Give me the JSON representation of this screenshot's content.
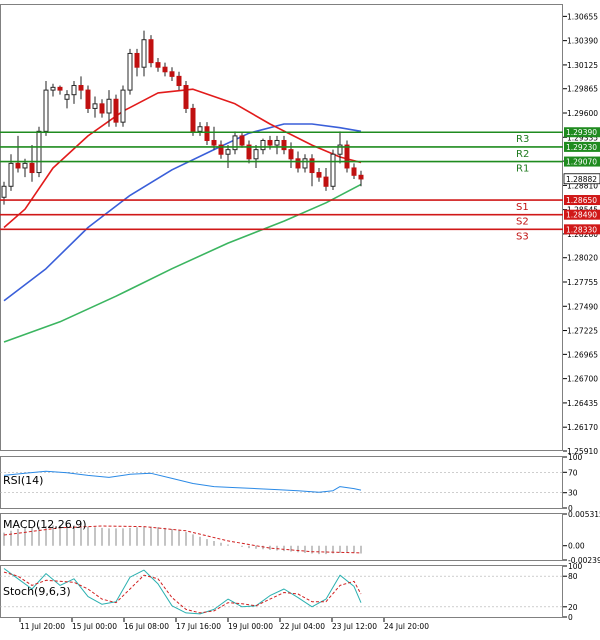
{
  "chart_data": [
    {
      "type": "candlestick",
      "panel": "main",
      "y_ticks": [
        "1.30655",
        "1.30390",
        "1.30125",
        "1.29865",
        "1.29600",
        "1.29335",
        "1.29075",
        "1.28810",
        "1.28545",
        "1.28280",
        "1.28020",
        "1.27755",
        "1.27490",
        "1.27225",
        "1.26965",
        "1.26700",
        "1.26435",
        "1.26170",
        "1.25910"
      ],
      "ylim": [
        1.2591,
        1.3079
      ],
      "x_labels": [
        "11 Jul 20:00",
        "15 Jul 00:00",
        "16 Jul 08:00",
        "17 Jul 16:00",
        "19 Jul 00:00",
        "22 Jul 04:00",
        "23 Jul 12:00",
        "24 Jul 20:00"
      ],
      "last_price": "1.28882",
      "colors": {
        "up": "#5a9a2a",
        "down": "#c01010",
        "ma_fast": "#e21b1b",
        "ma_mid": "#3a5fd9",
        "ma_slow": "#3bb560",
        "resistance": "#1f8b1f",
        "support": "#d01818"
      },
      "levels": [
        {
          "name": "R3",
          "value": 1.2939,
          "label": "1.29390"
        },
        {
          "name": "R2",
          "value": 1.2923,
          "label": "1.29230"
        },
        {
          "name": "R1",
          "value": 1.2907,
          "label": "1.29070"
        },
        {
          "name": "S1",
          "value": 1.2865,
          "label": "1.28650"
        },
        {
          "name": "S2",
          "value": 1.2849,
          "label": "1.28490"
        },
        {
          "name": "S3",
          "value": 1.2833,
          "label": "1.28330"
        }
      ],
      "candles": [
        [
          1.2868,
          1.2885,
          1.286,
          1.288
        ],
        [
          1.288,
          1.2915,
          1.2875,
          1.2905
        ],
        [
          1.2905,
          1.2935,
          1.2895,
          1.29
        ],
        [
          1.29,
          1.291,
          1.289,
          1.2905
        ],
        [
          1.2905,
          1.2925,
          1.2885,
          1.2895
        ],
        [
          1.2895,
          1.2945,
          1.289,
          1.294
        ],
        [
          1.294,
          1.2995,
          1.2935,
          1.2985
        ],
        [
          1.2985,
          1.2992,
          1.2978,
          1.2988
        ],
        [
          1.2988,
          1.299,
          1.298,
          1.2985
        ],
        [
          1.2975,
          1.2985,
          1.2965,
          1.298
        ],
        [
          1.298,
          1.2995,
          1.297,
          1.299
        ],
        [
          1.299,
          1.3,
          1.2975,
          1.2985
        ],
        [
          1.2985,
          1.299,
          1.296,
          1.2965
        ],
        [
          1.2965,
          1.2978,
          1.2955,
          1.297
        ],
        [
          1.297,
          1.2975,
          1.2955,
          1.296
        ],
        [
          1.296,
          1.2985,
          1.2945,
          1.2975
        ],
        [
          1.2975,
          1.298,
          1.2945,
          1.295
        ],
        [
          1.295,
          1.299,
          1.2945,
          1.2985
        ],
        [
          1.2985,
          1.303,
          1.298,
          1.3025
        ],
        [
          1.3025,
          1.303,
          1.3,
          1.301
        ],
        [
          1.301,
          1.305,
          1.3,
          1.304
        ],
        [
          1.304,
          1.3045,
          1.301,
          1.3015
        ],
        [
          1.3015,
          1.302,
          1.3005,
          1.301
        ],
        [
          1.301,
          1.3015,
          1.3,
          1.3005
        ],
        [
          1.3005,
          1.301,
          1.2995,
          1.3
        ],
        [
          1.3,
          1.3005,
          1.2985,
          1.299
        ],
        [
          1.299,
          1.2995,
          1.296,
          1.2965
        ],
        [
          1.2965,
          1.297,
          1.2935,
          1.294
        ],
        [
          1.294,
          1.295,
          1.2935,
          1.2945
        ],
        [
          1.2945,
          1.295,
          1.2925,
          1.293
        ],
        [
          1.293,
          1.2945,
          1.292,
          1.2925
        ],
        [
          1.2925,
          1.293,
          1.291,
          1.2915
        ],
        [
          1.2915,
          1.2925,
          1.29,
          1.292
        ],
        [
          1.292,
          1.294,
          1.2915,
          1.2935
        ],
        [
          1.2935,
          1.2938,
          1.2922,
          1.2925
        ],
        [
          1.2925,
          1.293,
          1.2905,
          1.291
        ],
        [
          1.291,
          1.2925,
          1.29,
          1.292
        ],
        [
          1.292,
          1.2932,
          1.2915,
          1.293
        ],
        [
          1.293,
          1.2935,
          1.292,
          1.2925
        ],
        [
          1.2925,
          1.2935,
          1.2915,
          1.293
        ],
        [
          1.293,
          1.2935,
          1.2915,
          1.292
        ],
        [
          1.292,
          1.2928,
          1.29,
          1.291
        ],
        [
          1.291,
          1.2918,
          1.2895,
          1.29
        ],
        [
          1.29,
          1.2915,
          1.2895,
          1.291
        ],
        [
          1.291,
          1.2915,
          1.288,
          1.2895
        ],
        [
          1.2895,
          1.29,
          1.2885,
          1.289
        ],
        [
          1.289,
          1.29,
          1.2875,
          1.288
        ],
        [
          1.288,
          1.292,
          1.2876,
          1.2915
        ],
        [
          1.2915,
          1.294,
          1.2905,
          1.2925
        ],
        [
          1.2925,
          1.293,
          1.2895,
          1.29
        ],
        [
          1.29,
          1.2905,
          1.2888,
          1.2892
        ],
        [
          1.2892,
          1.2897,
          1.288,
          1.2888
        ]
      ],
      "ma_fast": [
        [
          0,
          1.2835
        ],
        [
          3,
          1.2855
        ],
        [
          7,
          1.29
        ],
        [
          12,
          1.2935
        ],
        [
          17,
          1.2962
        ],
        [
          22,
          1.2982
        ],
        [
          27,
          1.2986
        ],
        [
          33,
          1.297
        ],
        [
          38,
          1.2948
        ],
        [
          44,
          1.2925
        ],
        [
          48,
          1.2912
        ],
        [
          51,
          1.2906
        ]
      ],
      "ma_mid": [
        [
          0,
          1.2755
        ],
        [
          6,
          1.279
        ],
        [
          12,
          1.2835
        ],
        [
          18,
          1.287
        ],
        [
          24,
          1.2898
        ],
        [
          30,
          1.292
        ],
        [
          35,
          1.2938
        ],
        [
          40,
          1.2948
        ],
        [
          44,
          1.2948
        ],
        [
          48,
          1.2944
        ],
        [
          51,
          1.294
        ]
      ],
      "ma_slow": [
        [
          0,
          1.271
        ],
        [
          8,
          1.2732
        ],
        [
          16,
          1.276
        ],
        [
          24,
          1.279
        ],
        [
          32,
          1.2818
        ],
        [
          40,
          1.2842
        ],
        [
          46,
          1.2862
        ],
        [
          51,
          1.2882
        ]
      ]
    },
    {
      "type": "line",
      "panel": "rsi",
      "title": "RSI(14)",
      "y_ticks": [
        "100",
        "70",
        "30",
        "0"
      ],
      "ylim": [
        0,
        100
      ],
      "series": [
        {
          "color": "#2b8ae6",
          "values": [
            [
              0,
              64
            ],
            [
              3,
              68
            ],
            [
              6,
              72
            ],
            [
              9,
              69
            ],
            [
              12,
              64
            ],
            [
              15,
              60
            ],
            [
              18,
              66
            ],
            [
              21,
              68
            ],
            [
              24,
              58
            ],
            [
              27,
              48
            ],
            [
              30,
              42
            ],
            [
              33,
              40
            ],
            [
              36,
              38
            ],
            [
              39,
              36
            ],
            [
              42,
              34
            ],
            [
              45,
              31
            ],
            [
              47,
              34
            ],
            [
              48,
              42
            ],
            [
              50,
              38
            ],
            [
              51,
              35
            ]
          ]
        }
      ],
      "levels": [
        70,
        30
      ]
    },
    {
      "type": "bar",
      "panel": "macd",
      "title": "MACD(12,26,9)",
      "y_ticks": [
        "0.005315",
        "0.00",
        "-0.002394"
      ],
      "ylim": [
        -0.002394,
        0.005315
      ],
      "histogram_color": "#888888",
      "signal_color": "#d02020",
      "histogram": [
        0.0022,
        0.0025,
        0.0028,
        0.003,
        0.0031,
        0.0032,
        0.0033,
        0.0034,
        0.0034,
        0.0034,
        0.0034,
        0.0033,
        0.0032,
        0.0031,
        0.003,
        0.0029,
        0.0029,
        0.0029,
        0.003,
        0.0031,
        0.0032,
        0.0032,
        0.0031,
        0.003,
        0.0028,
        0.0026,
        0.0023,
        0.0019,
        0.0015,
        0.0011,
        0.0008,
        0.0005,
        0.0002,
        0.0,
        -0.0002,
        -0.0004,
        -0.0005,
        -0.0006,
        -0.0007,
        -0.0008,
        -0.0009,
        -0.001,
        -0.0011,
        -0.0012,
        -0.0013,
        -0.0014,
        -0.0014,
        -0.0013,
        -0.0012,
        -0.0012,
        -0.0012,
        -0.0013
      ],
      "signal": [
        [
          0,
          0.0018
        ],
        [
          8,
          0.003
        ],
        [
          14,
          0.0033
        ],
        [
          20,
          0.0032
        ],
        [
          26,
          0.0025
        ],
        [
          32,
          0.0008
        ],
        [
          38,
          -0.0004
        ],
        [
          44,
          -0.001
        ],
        [
          51,
          -0.0012
        ]
      ]
    },
    {
      "type": "line",
      "panel": "stoch",
      "title": "Stoch(9,6,3)",
      "y_ticks": [
        "100",
        "80",
        "20",
        "0"
      ],
      "ylim": [
        0,
        100
      ],
      "series": [
        {
          "color": "#2bb0b0",
          "values": [
            [
              0,
              95
            ],
            [
              2,
              75
            ],
            [
              4,
              55
            ],
            [
              6,
              85
            ],
            [
              8,
              62
            ],
            [
              10,
              75
            ],
            [
              12,
              40
            ],
            [
              14,
              25
            ],
            [
              16,
              30
            ],
            [
              18,
              78
            ],
            [
              20,
              92
            ],
            [
              22,
              65
            ],
            [
              24,
              22
            ],
            [
              26,
              8
            ],
            [
              28,
              6
            ],
            [
              30,
              15
            ],
            [
              32,
              35
            ],
            [
              34,
              20
            ],
            [
              36,
              22
            ],
            [
              38,
              42
            ],
            [
              40,
              55
            ],
            [
              42,
              38
            ],
            [
              44,
              20
            ],
            [
              46,
              35
            ],
            [
              48,
              82
            ],
            [
              50,
              60
            ],
            [
              51,
              28
            ]
          ]
        },
        {
          "color": "#d02020",
          "dashed": true,
          "values": [
            [
              0,
              88
            ],
            [
              2,
              80
            ],
            [
              4,
              62
            ],
            [
              6,
              72
            ],
            [
              8,
              70
            ],
            [
              10,
              68
            ],
            [
              12,
              55
            ],
            [
              14,
              35
            ],
            [
              16,
              28
            ],
            [
              18,
              55
            ],
            [
              20,
              82
            ],
            [
              22,
              75
            ],
            [
              24,
              38
            ],
            [
              26,
              15
            ],
            [
              28,
              8
            ],
            [
              30,
              12
            ],
            [
              32,
              28
            ],
            [
              34,
              26
            ],
            [
              36,
              22
            ],
            [
              38,
              35
            ],
            [
              40,
              48
            ],
            [
              42,
              45
            ],
            [
              44,
              30
            ],
            [
              46,
              30
            ],
            [
              48,
              62
            ],
            [
              50,
              70
            ],
            [
              51,
              45
            ]
          ]
        }
      ],
      "levels": [
        80,
        20
      ]
    }
  ]
}
